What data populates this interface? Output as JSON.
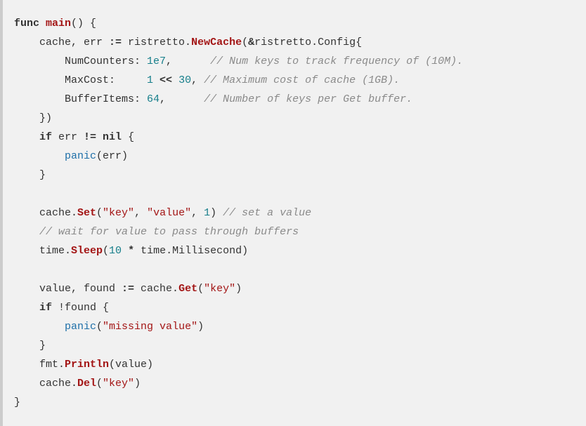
{
  "code": {
    "l1_func": "func",
    "l1_main": "main",
    "l1_rest": "() {",
    "l2_pre": "    cache, err ",
    "l2_op": ":=",
    "l2_mid": " ristretto.",
    "l2_new": "NewCache",
    "l2_open": "(",
    "l2_amp": "&",
    "l2_rest": "ristretto.Config{",
    "l3_pre": "        NumCounters: ",
    "l3_num": "1e7",
    "l3_comma": ",      ",
    "l3_cm": "// Num keys to track frequency of (10M).",
    "l4_pre": "        MaxCost:     ",
    "l4_num1": "1",
    "l4_op": " << ",
    "l4_num2": "30",
    "l4_comma": ", ",
    "l4_cm": "// Maximum cost of cache (1GB).",
    "l5_pre": "        BufferItems: ",
    "l5_num": "64",
    "l5_comma": ",      ",
    "l5_cm": "// Number of keys per Get buffer.",
    "l6": "    })",
    "l7_if": "    if",
    "l7_cond": " err ",
    "l7_op": "!=",
    "l7_nil": " nil",
    "l7_brace": " {",
    "l8_indent": "        ",
    "l8_panic": "panic",
    "l8_rest": "(err)",
    "l9": "    }",
    "l10": "",
    "l11_pre": "    cache.",
    "l11_set": "Set",
    "l11_open": "(",
    "l11_s1": "\"key\"",
    "l11_c1": ", ",
    "l11_s2": "\"value\"",
    "l11_c2": ", ",
    "l11_n": "1",
    "l11_close": ") ",
    "l11_cm": "// set a value",
    "l12_sp": "    ",
    "l12_cm": "// wait for value to pass through buffers",
    "l13_pre": "    time.",
    "l13_sleep": "Sleep",
    "l13_open": "(",
    "l13_n": "10",
    "l13_op": " * ",
    "l13_rest": "time.Millisecond)",
    "l14": "",
    "l15_pre": "    value, found ",
    "l15_op": ":=",
    "l15_mid": " cache.",
    "l15_get": "Get",
    "l15_open": "(",
    "l15_s": "\"key\"",
    "l15_close": ")",
    "l16_if": "    if",
    "l16_cond": " !found {",
    "l17_indent": "        ",
    "l17_panic": "panic",
    "l17_open": "(",
    "l17_s": "\"missing value\"",
    "l17_close": ")",
    "l18": "    }",
    "l19_pre": "    fmt.",
    "l19_println": "Println",
    "l19_rest": "(value)",
    "l20_pre": "    cache.",
    "l20_del": "Del",
    "l20_open": "(",
    "l20_s": "\"key\"",
    "l20_close": ")",
    "l21": "}"
  }
}
